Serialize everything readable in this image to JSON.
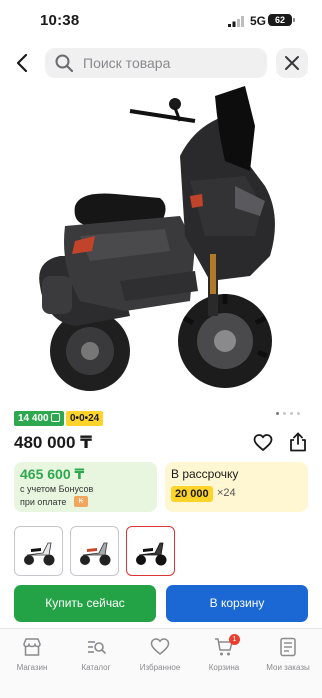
{
  "status_bar": {
    "time": "10:38",
    "network": "5G",
    "battery": "62"
  },
  "search": {
    "placeholder": "Поиск товара"
  },
  "product": {
    "price": "480 000 ₸",
    "badges": {
      "bonus": "14 400",
      "installment": "0•0•24"
    },
    "image_count": 4,
    "active_image": 1
  },
  "bonus_offer": {
    "price": "465 600 ₸",
    "line1": "с учетом Бонусов",
    "line2": "при оплате",
    "pay_icon": "kaspi-icon"
  },
  "installment_offer": {
    "title": "В рассрочку",
    "monthly": "20 000",
    "months": "×24"
  },
  "variants": {
    "count": 3,
    "selected": 3
  },
  "actions": {
    "buy_now": "Купить сейчас",
    "add_to_cart": "В корзину"
  },
  "tabbar": {
    "items": [
      {
        "label": "Магазин",
        "icon": "store-icon"
      },
      {
        "label": "Каталог",
        "icon": "catalog-icon"
      },
      {
        "label": "Избранное",
        "icon": "heart-icon"
      },
      {
        "label": "Корзина",
        "icon": "cart-icon",
        "badge": "1"
      },
      {
        "label": "Мои заказы",
        "icon": "orders-icon"
      }
    ]
  },
  "colors": {
    "green": "#24a346",
    "blue": "#1b67d3",
    "yellow": "#fed42b",
    "red": "#e03333"
  }
}
